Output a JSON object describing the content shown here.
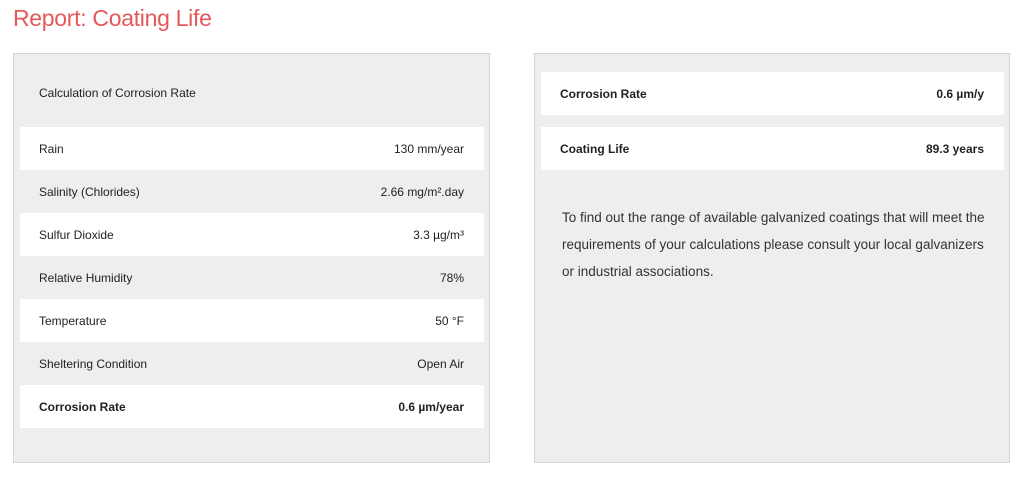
{
  "title": "Report: Coating Life",
  "left": {
    "heading": "Calculation of Corrosion Rate",
    "rows": [
      {
        "label": "Rain",
        "value": "130 mm/year"
      },
      {
        "label": "Salinity (Chlorides)",
        "value": "2.66 mg/m².day"
      },
      {
        "label": "Sulfur Dioxide",
        "value": "3.3 µg/m³"
      },
      {
        "label": "Relative Humidity",
        "value": "78%"
      },
      {
        "label": "Temperature",
        "value": "50 °F"
      },
      {
        "label": "Sheltering Condition",
        "value": "Open Air"
      },
      {
        "label": "Corrosion Rate",
        "value": "0.6 µm/year"
      }
    ]
  },
  "right": {
    "rows": [
      {
        "label": "Corrosion Rate",
        "value": "0.6 µm/y"
      },
      {
        "label": "Coating Life",
        "value": "89.3 years"
      }
    ],
    "note": "To find out the range of available galvanized coatings that will meet the requirements of your calculations please consult your local galvanizers or industrial associations."
  }
}
